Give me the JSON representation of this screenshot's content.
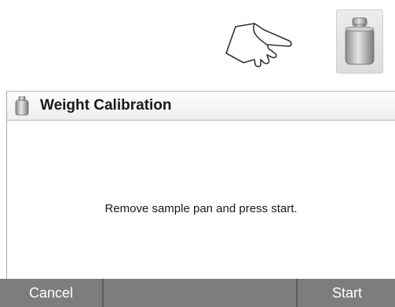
{
  "icons": {
    "pointer": "hand-pointing-right-icon",
    "weight": "calibration-weight-icon"
  },
  "dialog": {
    "title": "Weight Calibration",
    "message": "Remove  sample pan and press start."
  },
  "footer": {
    "cancel_label": "Cancel",
    "start_label": "Start"
  },
  "colors": {
    "footer_bg": "#7d7d7d",
    "button_text": "#ffffff",
    "title_text": "#1a1a1a"
  }
}
